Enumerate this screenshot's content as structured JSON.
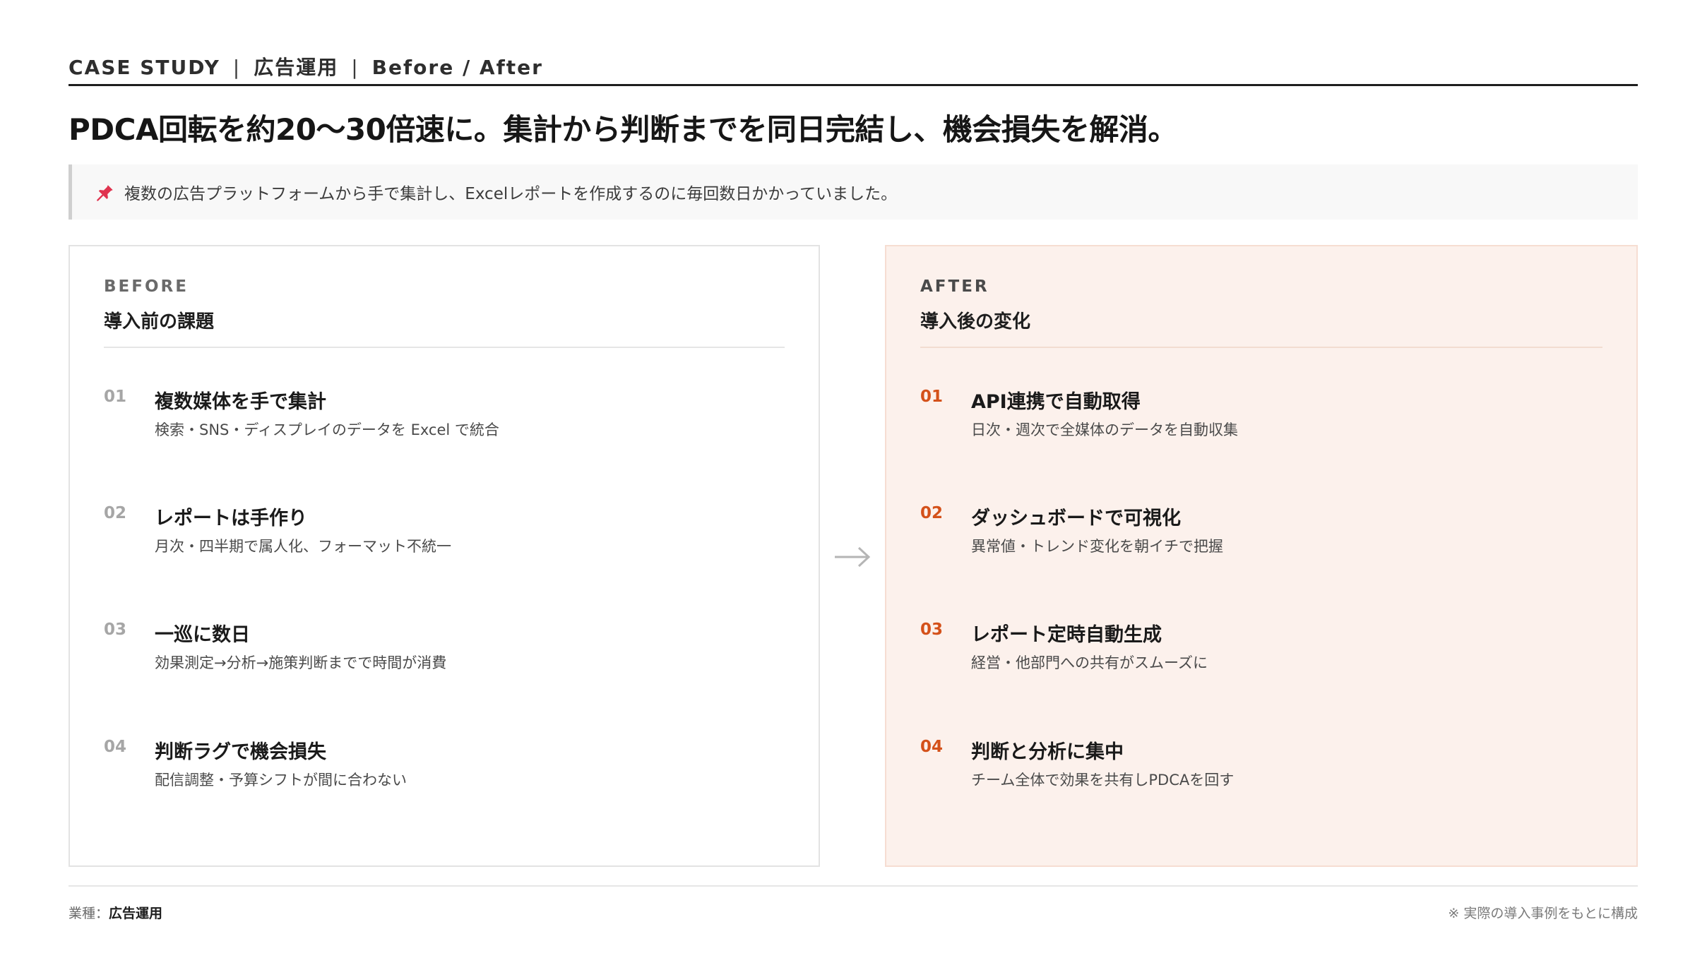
{
  "header": {
    "eyebrow_1": "CASE STUDY",
    "separator": "|",
    "eyebrow_2": "広告運用",
    "eyebrow_3": "Before / After"
  },
  "headline": "PDCA回転を約20〜30倍速に。集計から判断までを同日完結し、機会損失を解消。",
  "note": {
    "icon": "pushpin-icon",
    "text": "複数の広告プラットフォームから手で集計し、Excelレポートを作成するのに毎回数日かかっていました。"
  },
  "before": {
    "label": "BEFORE",
    "title": "導入前の課題",
    "items": [
      {
        "num": "01",
        "title": "複数媒体を手で集計",
        "desc": "検索・SNS・ディスプレイのデータを Excel で統合"
      },
      {
        "num": "02",
        "title": "レポートは手作り",
        "desc": "月次・四半期で属人化、フォーマット不統一"
      },
      {
        "num": "03",
        "title": "一巡に数日",
        "desc": "効果測定→分析→施策判断までで時間が消費"
      },
      {
        "num": "04",
        "title": "判断ラグで機会損失",
        "desc": "配信調整・予算シフトが間に合わない"
      }
    ]
  },
  "after": {
    "label": "AFTER",
    "title": "導入後の変化",
    "items": [
      {
        "num": "01",
        "title": "API連携で自動取得",
        "desc": "日次・週次で全媒体のデータを自動収集"
      },
      {
        "num": "02",
        "title": "ダッシュボードで可視化",
        "desc": "異常値・トレンド変化を朝イチで把握"
      },
      {
        "num": "03",
        "title": "レポート定時自動生成",
        "desc": "経営・他部門への共有がスムーズに"
      },
      {
        "num": "04",
        "title": "判断と分析に集中",
        "desc": "チーム全体で効果を共有しPDCAを回す"
      }
    ]
  },
  "footer": {
    "industry_label": "業種：",
    "industry_value": "広告運用",
    "note": "※ 実際の導入事例をもとに構成"
  },
  "colors": {
    "accent": "#d4511a",
    "after_bg": "#fcf1ec",
    "pin": "#e0334f"
  }
}
